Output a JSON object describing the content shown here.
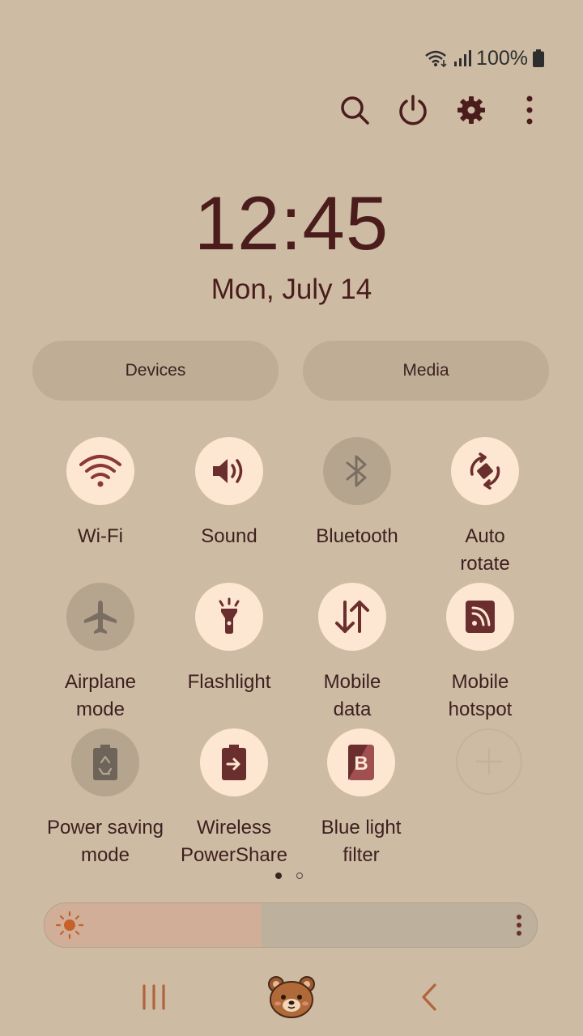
{
  "status": {
    "battery_pct": "100%"
  },
  "header": {
    "actions": [
      {
        "name": "search-icon"
      },
      {
        "name": "power-icon"
      },
      {
        "name": "settings-icon"
      },
      {
        "name": "more-options-icon"
      }
    ]
  },
  "clock": {
    "time": "12:45",
    "date": "Mon, July 14"
  },
  "panels": {
    "devices": "Devices",
    "media": "Media"
  },
  "tiles": [
    {
      "label": "Wi-Fi",
      "state": "on",
      "icon": "wifi-icon"
    },
    {
      "label": "Sound",
      "state": "on",
      "icon": "volume-icon"
    },
    {
      "label": "Bluetooth",
      "state": "off",
      "icon": "bluetooth-icon"
    },
    {
      "label": "Auto\nrotate",
      "state": "on",
      "icon": "auto-rotate-icon"
    },
    {
      "label": "Airplane\nmode",
      "state": "off",
      "icon": "airplane-icon"
    },
    {
      "label": "Flashlight",
      "state": "on",
      "icon": "flashlight-icon"
    },
    {
      "label": "Mobile\ndata",
      "state": "on",
      "icon": "mobile-data-icon"
    },
    {
      "label": "Mobile\nhotspot",
      "state": "on",
      "icon": "hotspot-icon"
    },
    {
      "label": "Power saving\nmode",
      "state": "off",
      "icon": "power-saving-icon"
    },
    {
      "label": "Wireless\nPowerShare",
      "state": "on",
      "icon": "wireless-powershare-icon"
    },
    {
      "label": "Blue light\nfilter",
      "state": "on",
      "icon": "blue-light-filter-icon"
    },
    {
      "label": "",
      "state": "add",
      "icon": "add-tile-icon"
    }
  ],
  "pager": {
    "current": 1,
    "total": 2
  },
  "brightness": {
    "level": 0.44
  },
  "colors": {
    "background": "#cdbba3",
    "tile_on": "#fde6d2",
    "tile_off": "#b5a58f",
    "icon_on": "#6b2e2e",
    "accent": "#b2643c"
  }
}
